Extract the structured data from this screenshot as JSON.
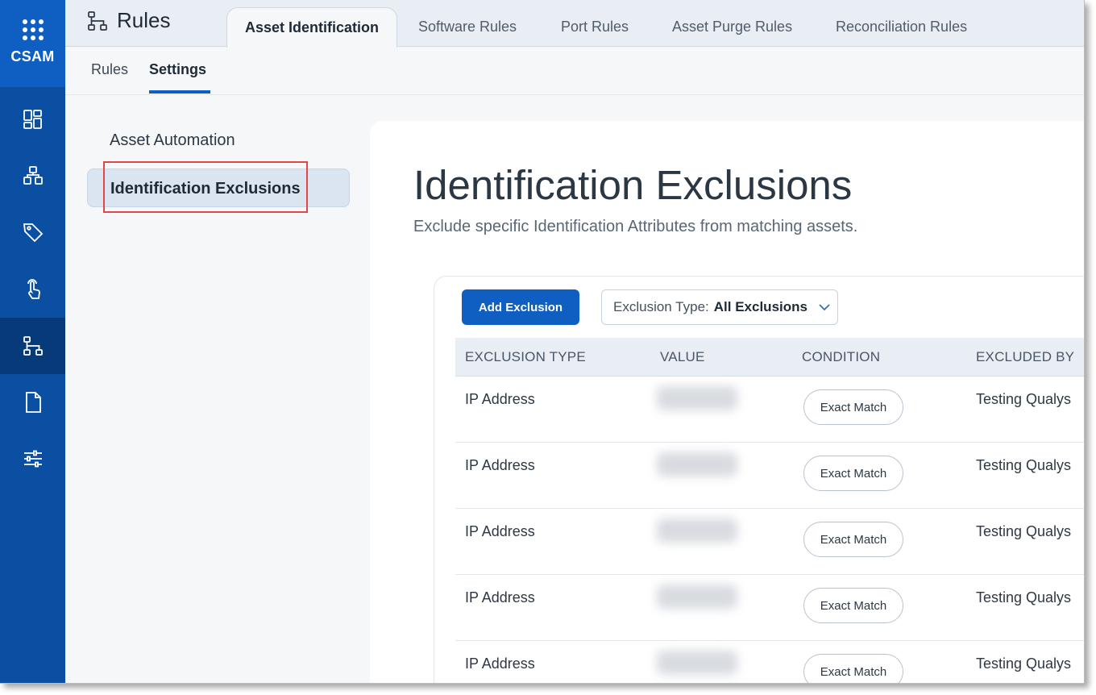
{
  "app": {
    "name": "CSAM"
  },
  "rail": {
    "items": [
      {
        "icon": "dashboard-icon"
      },
      {
        "icon": "inventory-icon"
      },
      {
        "icon": "tag-icon"
      },
      {
        "icon": "touch-icon"
      },
      {
        "icon": "rules-icon",
        "active": true
      },
      {
        "icon": "document-icon"
      },
      {
        "icon": "sliders-icon"
      }
    ]
  },
  "header": {
    "title": "Rules",
    "tabs": [
      {
        "label": "Asset Identification",
        "active": true
      },
      {
        "label": "Software Rules"
      },
      {
        "label": "Port Rules"
      },
      {
        "label": "Asset Purge Rules"
      },
      {
        "label": "Reconciliation Rules"
      }
    ]
  },
  "subtabs": [
    {
      "label": "Rules"
    },
    {
      "label": "Settings",
      "active": true
    }
  ],
  "menu": {
    "items": [
      {
        "label": "Asset Automation"
      },
      {
        "label": "Identification Exclusions",
        "active": true
      }
    ]
  },
  "main": {
    "title": "Identification Exclusions",
    "subtitle": "Exclude specific Identification Attributes from matching assets.",
    "add_button": "Add Exclusion",
    "filter": {
      "label": "Exclusion Type:",
      "value": "All Exclusions"
    },
    "columns": [
      "EXCLUSION TYPE",
      "VALUE",
      "CONDITION",
      "EXCLUDED BY"
    ],
    "rows": [
      {
        "type": "IP Address",
        "value": "",
        "condition": "Exact Match",
        "excluded_by": "Testing Qualys"
      },
      {
        "type": "IP Address",
        "value": "",
        "condition": "Exact Match",
        "excluded_by": "Testing Qualys"
      },
      {
        "type": "IP Address",
        "value": "",
        "condition": "Exact Match",
        "excluded_by": "Testing Qualys"
      },
      {
        "type": "IP Address",
        "value": "",
        "condition": "Exact Match",
        "excluded_by": "Testing Qualys"
      },
      {
        "type": "IP Address",
        "value": "",
        "condition": "Exact Match",
        "excluded_by": "Testing Qualys"
      }
    ]
  },
  "colors": {
    "brand": "#0e5fc1",
    "rail": "#0b4fa3",
    "highlight": "#e04848"
  }
}
